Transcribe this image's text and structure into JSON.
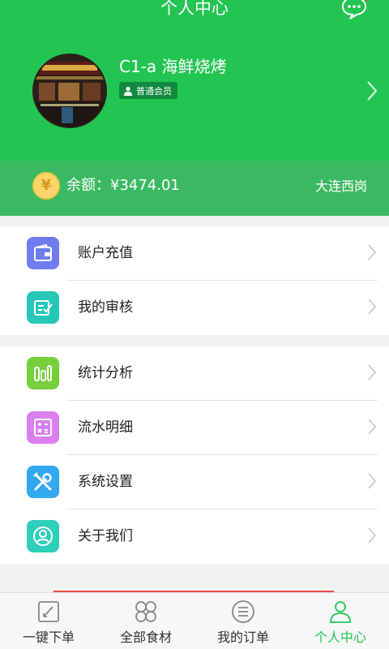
{
  "header": {
    "title": "个人中心",
    "user_name": "C1-a 海鲜烧烤",
    "member_level": "普通会员"
  },
  "balance": {
    "coin_symbol": "¥",
    "label": "余额：¥3474.01",
    "branch": "大连西岗"
  },
  "menu_group_1": [
    {
      "label": "账户充值",
      "icon": "wallet-icon",
      "color": "#6f7cf0"
    },
    {
      "label": "我的审核",
      "icon": "review-icon",
      "color": "#25c7b6"
    }
  ],
  "menu_group_2": [
    {
      "label": "统计分析",
      "icon": "chart-icon",
      "color": "#77cf3c"
    },
    {
      "label": "流水明细",
      "icon": "calculator-icon",
      "color": "#d97ff0"
    },
    {
      "label": "系统设置",
      "icon": "tools-icon",
      "color": "#31a8f0"
    },
    {
      "label": "关于我们",
      "icon": "person-circle-icon",
      "color": "#2fcfb8"
    }
  ],
  "bottom_nav": [
    {
      "label": "一键下单",
      "icon": "quick-order-icon",
      "active": false
    },
    {
      "label": "全部食材",
      "icon": "clover-grid-icon",
      "active": false
    },
    {
      "label": "我的订单",
      "icon": "order-list-icon",
      "active": false
    },
    {
      "label": "个人中心",
      "icon": "profile-icon",
      "active": true
    }
  ],
  "colors": {
    "brand_green": "#23c552",
    "balance_green": "#3bb962",
    "active_nav": "#23c552"
  }
}
